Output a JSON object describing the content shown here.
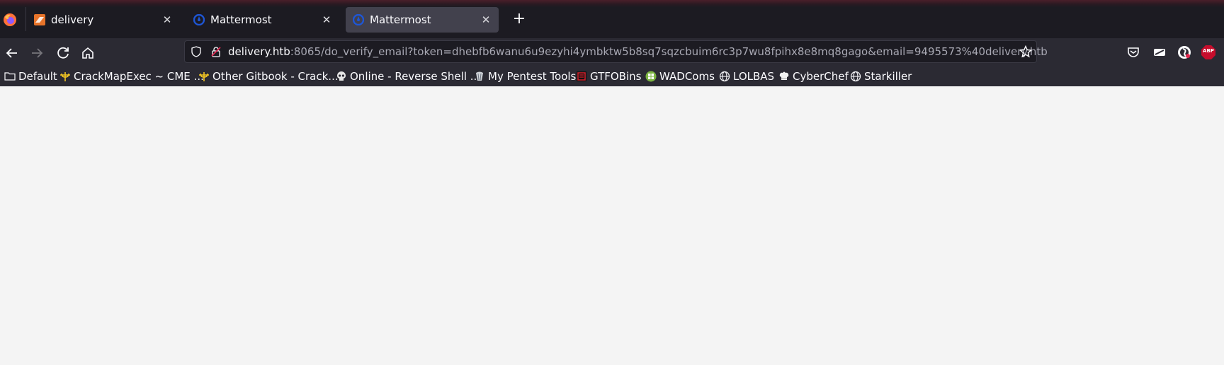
{
  "tabs": [
    {
      "title": "delivery",
      "active": false
    },
    {
      "title": "Mattermost",
      "active": false
    },
    {
      "title": "Mattermost",
      "active": true
    }
  ],
  "tab_close_glyph": "✕",
  "new_tab_glyph": "+",
  "address": {
    "host": "delivery.htb",
    "rest": ":8065/do_verify_email?token=dhebfb6wanu6u9ezyhi4ymbktw5b8sq7sqzcbuim6rc3p7wu8fpihx8e8mq8gago&email=9495573%40delivery.htb"
  },
  "bookmarks": [
    {
      "label": "Default",
      "icon": "folder-icon"
    },
    {
      "label": "CrackMapExec ~ CME ...",
      "icon": "trident-icon"
    },
    {
      "label": "Other Gitbook - Crack...",
      "icon": "trident-icon"
    },
    {
      "label": "Online - Reverse Shell ...",
      "icon": "skull-icon"
    },
    {
      "label": "My Pentest Tools",
      "icon": "shell-icon"
    },
    {
      "label": "GTFOBins",
      "icon": "gtfobins-icon"
    },
    {
      "label": "WADComs",
      "icon": "wadcoms-icon"
    },
    {
      "label": "LOLBAS",
      "icon": "globe-icon"
    },
    {
      "label": "CyberChef",
      "icon": "chef-icon"
    },
    {
      "label": "Starkiller",
      "icon": "globe-icon"
    }
  ],
  "extensions": [
    "pocket-icon",
    "extension-icon",
    "account-icon",
    "adblock-icon"
  ],
  "adblock_label": "ABP",
  "colors": {
    "chrome_bg": "#2b2a33",
    "tabstrip_bg": "#1c1b22",
    "active_tab": "#42414d",
    "content_bg": "#f4f4f4",
    "mattermost_blue": "#1e56d6"
  }
}
